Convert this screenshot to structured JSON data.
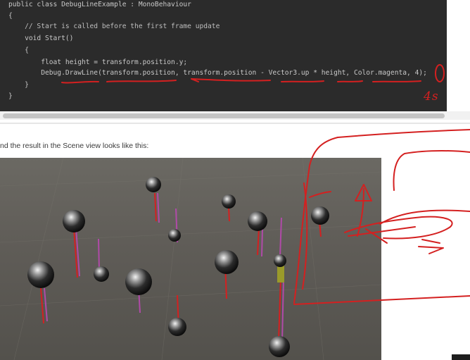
{
  "code": {
    "lines": [
      "public class DebugLineExample : MonoBehaviour",
      "{",
      "    // Start is called before the first frame update",
      "    void Start()",
      "    {",
      "        float height = transform.position.y;",
      "        Debug.DrawLine(transform.position, transform.position - Vector3.up * height, Color.magenta, 4);",
      "    }",
      "}"
    ]
  },
  "caption": "nd the result in the Scene view looks like this:",
  "annotations": {
    "handwritten_note": "4s"
  },
  "colors": {
    "code_bg": "#2b2b2b",
    "code_text": "#c8c8c8",
    "scene_bg": "#5f5c57",
    "ink": "#d42020",
    "magenta_line": "#b04aa8",
    "red_line": "#d42020"
  }
}
